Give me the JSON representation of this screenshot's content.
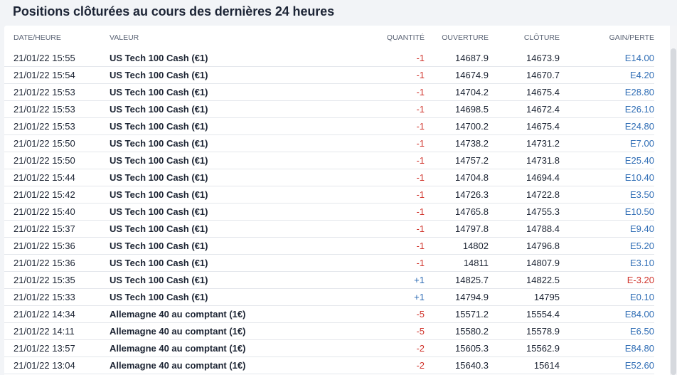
{
  "page": {
    "title": "Positions clôturées au cours des dernières 24 heures"
  },
  "colors": {
    "negative_quantity": "#d0342c",
    "positive_quantity": "#2f6db5",
    "gain": "#2f6db5",
    "loss": "#d0342c"
  },
  "table": {
    "headers": {
      "date": "DATE/HEURE",
      "asset": "VALEUR",
      "quantity": "QUANTITÉ",
      "open": "OUVERTURE",
      "close": "CLÔTURE",
      "pnl": "GAIN/PERTE"
    },
    "rows": [
      {
        "date": "21/01/22 15:55",
        "asset": "US Tech 100 Cash (€1)",
        "quantity": "-1",
        "open": "14687.9",
        "close": "14673.9",
        "pnl": "E14.00"
      },
      {
        "date": "21/01/22 15:54",
        "asset": "US Tech 100 Cash (€1)",
        "quantity": "-1",
        "open": "14674.9",
        "close": "14670.7",
        "pnl": "E4.20"
      },
      {
        "date": "21/01/22 15:53",
        "asset": "US Tech 100 Cash (€1)",
        "quantity": "-1",
        "open": "14704.2",
        "close": "14675.4",
        "pnl": "E28.80"
      },
      {
        "date": "21/01/22 15:53",
        "asset": "US Tech 100 Cash (€1)",
        "quantity": "-1",
        "open": "14698.5",
        "close": "14672.4",
        "pnl": "E26.10"
      },
      {
        "date": "21/01/22 15:53",
        "asset": "US Tech 100 Cash (€1)",
        "quantity": "-1",
        "open": "14700.2",
        "close": "14675.4",
        "pnl": "E24.80"
      },
      {
        "date": "21/01/22 15:50",
        "asset": "US Tech 100 Cash (€1)",
        "quantity": "-1",
        "open": "14738.2",
        "close": "14731.2",
        "pnl": "E7.00"
      },
      {
        "date": "21/01/22 15:50",
        "asset": "US Tech 100 Cash (€1)",
        "quantity": "-1",
        "open": "14757.2",
        "close": "14731.8",
        "pnl": "E25.40"
      },
      {
        "date": "21/01/22 15:44",
        "asset": "US Tech 100 Cash (€1)",
        "quantity": "-1",
        "open": "14704.8",
        "close": "14694.4",
        "pnl": "E10.40"
      },
      {
        "date": "21/01/22 15:42",
        "asset": "US Tech 100 Cash (€1)",
        "quantity": "-1",
        "open": "14726.3",
        "close": "14722.8",
        "pnl": "E3.50"
      },
      {
        "date": "21/01/22 15:40",
        "asset": "US Tech 100 Cash (€1)",
        "quantity": "-1",
        "open": "14765.8",
        "close": "14755.3",
        "pnl": "E10.50"
      },
      {
        "date": "21/01/22 15:37",
        "asset": "US Tech 100 Cash (€1)",
        "quantity": "-1",
        "open": "14797.8",
        "close": "14788.4",
        "pnl": "E9.40"
      },
      {
        "date": "21/01/22 15:36",
        "asset": "US Tech 100 Cash (€1)",
        "quantity": "-1",
        "open": "14802",
        "close": "14796.8",
        "pnl": "E5.20"
      },
      {
        "date": "21/01/22 15:36",
        "asset": "US Tech 100 Cash (€1)",
        "quantity": "-1",
        "open": "14811",
        "close": "14807.9",
        "pnl": "E3.10"
      },
      {
        "date": "21/01/22 15:35",
        "asset": "US Tech 100 Cash (€1)",
        "quantity": "+1",
        "open": "14825.7",
        "close": "14822.5",
        "pnl": "E-3.20"
      },
      {
        "date": "21/01/22 15:33",
        "asset": "US Tech 100 Cash (€1)",
        "quantity": "+1",
        "open": "14794.9",
        "close": "14795",
        "pnl": "E0.10"
      },
      {
        "date": "21/01/22 14:34",
        "asset": "Allemagne 40 au comptant (1€)",
        "quantity": "-5",
        "open": "15571.2",
        "close": "15554.4",
        "pnl": "E84.00"
      },
      {
        "date": "21/01/22 14:11",
        "asset": "Allemagne 40 au comptant (1€)",
        "quantity": "-5",
        "open": "15580.2",
        "close": "15578.9",
        "pnl": "E6.50"
      },
      {
        "date": "21/01/22 13:57",
        "asset": "Allemagne 40 au comptant (1€)",
        "quantity": "-2",
        "open": "15605.3",
        "close": "15562.9",
        "pnl": "E84.80"
      },
      {
        "date": "21/01/22 13:04",
        "asset": "Allemagne 40 au comptant (1€)",
        "quantity": "-2",
        "open": "15640.3",
        "close": "15614",
        "pnl": "E52.60"
      }
    ]
  }
}
